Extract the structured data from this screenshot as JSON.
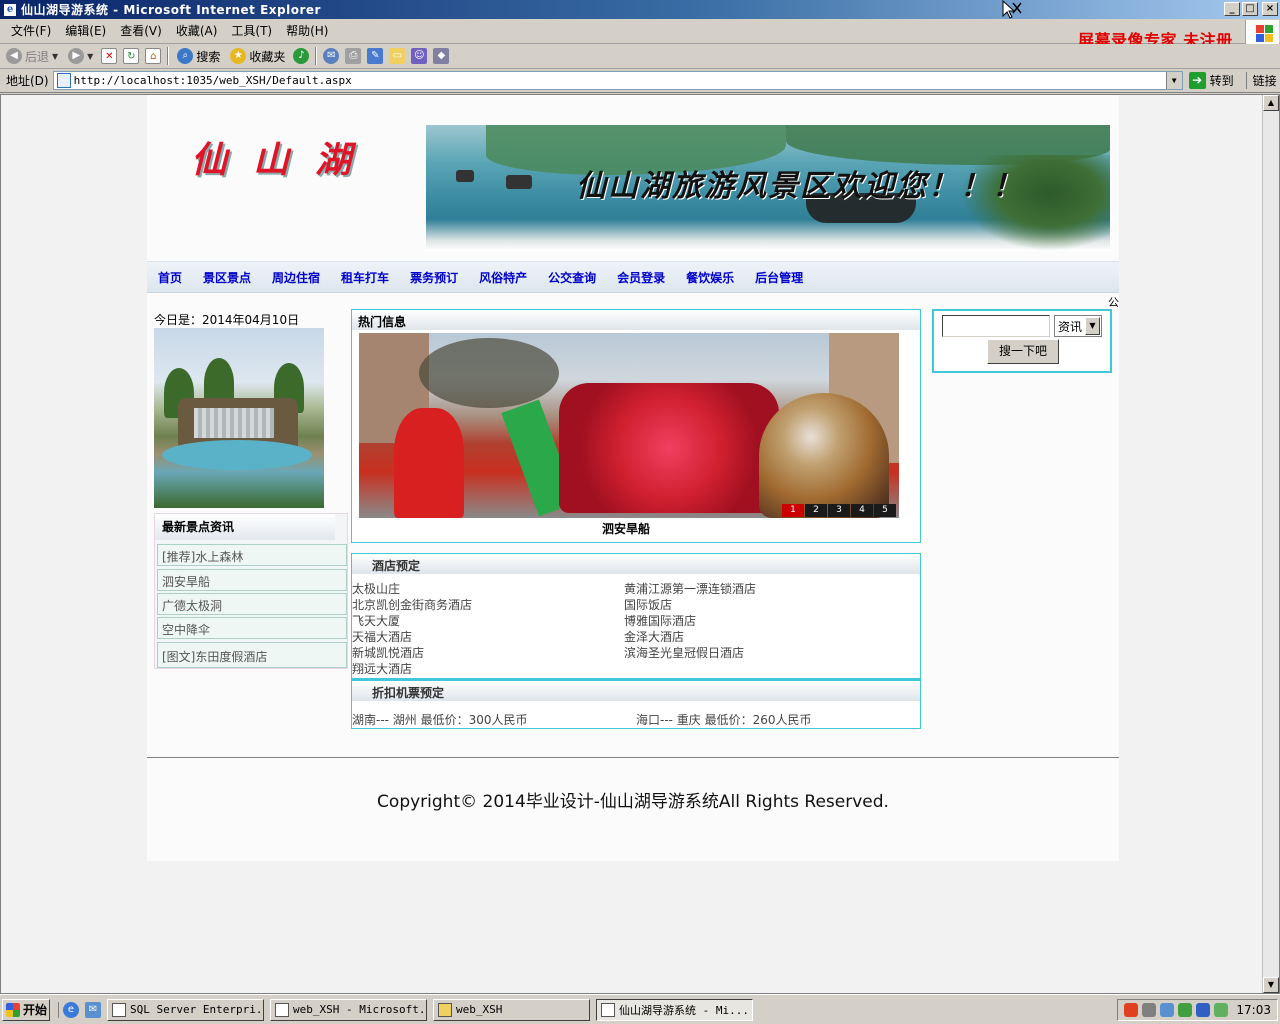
{
  "window": {
    "title": "仙山湖导游系统 - Microsoft Internet Explorer"
  },
  "menu": [
    "文件(F)",
    "编辑(E)",
    "查看(V)",
    "收藏(A)",
    "工具(T)",
    "帮助(H)"
  ],
  "watermark": "屏幕录像专家 未注册",
  "toolbar": {
    "back": "后退",
    "search": "搜索",
    "favorites": "收藏夹"
  },
  "address": {
    "label": "地址(D)",
    "url": "http://localhost:1035/web_XSH/Default.aspx",
    "go": "转到",
    "links": "链接"
  },
  "site": {
    "logo": "仙山湖",
    "banner_slogan": "仙山湖旅游风景区欢迎您！！！",
    "nav": [
      "首页",
      "景区景点",
      "周边住宿",
      "租车打车",
      "票务预订",
      "风俗特产",
      "公交查询",
      "会员登录",
      "餐饮娱乐",
      "后台管理"
    ],
    "gong": "公",
    "date_text": "今日是：2014年04月10日",
    "news": {
      "title": "最新景点资讯",
      "items": [
        "[推荐]水上森林",
        "泗安旱船",
        "广德太极洞",
        "空中降伞",
        "[图文]东田度假酒店"
      ]
    },
    "hot": {
      "title": "热门信息",
      "caption": "泗安旱船",
      "slides": [
        "1",
        "2",
        "3",
        "4",
        "5"
      ]
    },
    "hotel": {
      "title": "酒店预定",
      "left": [
        "太极山庄",
        "北京凯创金街商务酒店",
        "飞天大厦",
        "天福大酒店",
        "新城凯悦酒店",
        "翔远大酒店"
      ],
      "right": [
        "黄浦江源第一漂连锁酒店",
        "国际饭店",
        "博雅国际酒店",
        "金泽大酒店",
        "滨海圣光皇冠假日酒店"
      ]
    },
    "ticket": {
      "title": "折扣机票预定",
      "items": [
        "湖南--- 湖州  最低价：300人民币",
        "海口--- 重庆  最低价：260人民币"
      ]
    },
    "search": {
      "select_value": "资讯",
      "button": "搜一下吧"
    },
    "copyright": "Copyright© 2014毕业设计-仙山湖导游系统All Rights Reserved."
  },
  "taskbar": {
    "start": "开始",
    "tasks": [
      "SQL Server Enterpri...",
      "web_XSH - Microsoft...",
      "web_XSH",
      "仙山湖导游系统 - Mi..."
    ],
    "clock": "17:03"
  }
}
